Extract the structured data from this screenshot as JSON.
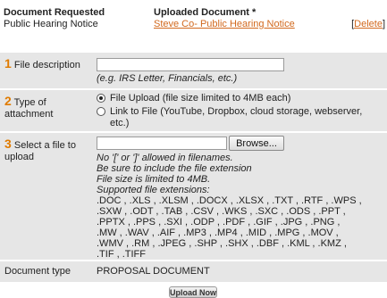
{
  "header": {
    "document_requested_label": "Document Requested",
    "document_requested_value": "Public Hearing Notice",
    "uploaded_document_label": "Uploaded Document *",
    "uploaded_document_link": "Steve Co- Public Hearing Notice",
    "delete_open": "[",
    "delete_label": "Delete",
    "delete_close": "]"
  },
  "step1": {
    "number": "1",
    "label": "File description",
    "input_value": "",
    "hint": "(e.g. IRS Letter, Financials, etc.)"
  },
  "step2": {
    "number": "2",
    "label": "Type of attachment",
    "options": [
      {
        "label": "File Upload (file size limited to 4MB each)",
        "selected": true
      },
      {
        "label": "Link to File (YouTube, Dropbox, cloud storage, webserver, etc.)",
        "selected": false
      }
    ]
  },
  "step3": {
    "number": "3",
    "label": "Select a file to upload",
    "browse_label": "Browse...",
    "notes": [
      "No '[' or ']' allowed in filenames.",
      "Be sure to include the file extension",
      "File size is limited to 4MB.",
      "Supported file extensions:"
    ],
    "extensions": [
      ".DOC , .XLS , .XLSM , .DOCX , .XLSX , .TXT , .RTF , .WPS ,",
      ".SXW , .ODT , .TAB , .CSV , .WKS , .SXC , .ODS , .PPT ,",
      ".PPTX , .PPS , .SXI , .ODP , .PDF , .GIF , .JPG , .PNG ,",
      ".MW , .WAV , .AIF , .MP3 , .MP4 , .MID , .MPG , .MOV ,",
      ".WMV , .RM , .JPEG , .SHP , .SHX , .DBF , .KML , .KMZ ,",
      ".TIF , .TIFF"
    ]
  },
  "doctype": {
    "label": "Document type",
    "value": "PROPOSAL DOCUMENT"
  },
  "actions": {
    "upload_label": "Upload Now"
  },
  "colors": {
    "step_number": "#e07b00",
    "link": "#d2691e",
    "row_bg": "#e6e6e6"
  }
}
